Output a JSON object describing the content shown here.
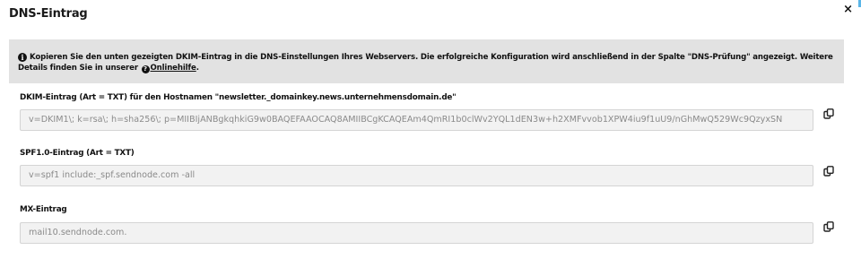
{
  "dialog": {
    "title": "DNS-Eintrag",
    "close_label": "×"
  },
  "info": {
    "icon": "info-icon",
    "text_before_link": "Kopieren Sie den unten gezeigten DKIM-Eintrag in die DNS-Einstellungen Ihres Webservers. Die erfolgreiche Konfiguration wird anschließend in der Spalte \"DNS-Prüfung\" angezeigt. Weitere Details finden Sie in unserer",
    "help_icon": "help-circle-icon",
    "link_text": "Onlinehilfe",
    "text_after_link": "."
  },
  "fields": [
    {
      "label": "DKIM-Eintrag (Art = TXT) für den Hostnamen \"newsletter._domainkey.news.unternehmensdomain.de\"",
      "value": "v=DKIM1\\; k=rsa\\; h=sha256\\; p=MIIBIjANBgkqhkiG9w0BAQEFAAOCAQ8AMIIBCgKCAQEAm4QmRI1b0clWv2YQL1dEN3w+h2XMFvvob1XPW4iu9f1uU9/nGhMwQ529Wc9QzyxSN"
    },
    {
      "label": "SPF1.0-Eintrag (Art = TXT)",
      "value": "v=spf1 include:_spf.sendnode.com -all"
    },
    {
      "label": "MX-Eintrag",
      "value": "mail10.sendnode.com."
    }
  ],
  "copy_icon": "copy-icon",
  "colors": {
    "info_background": "#e2e2e2",
    "input_background": "#f2f2f2",
    "input_text": "#8a8a8a",
    "accent": "#5bb6e8"
  }
}
